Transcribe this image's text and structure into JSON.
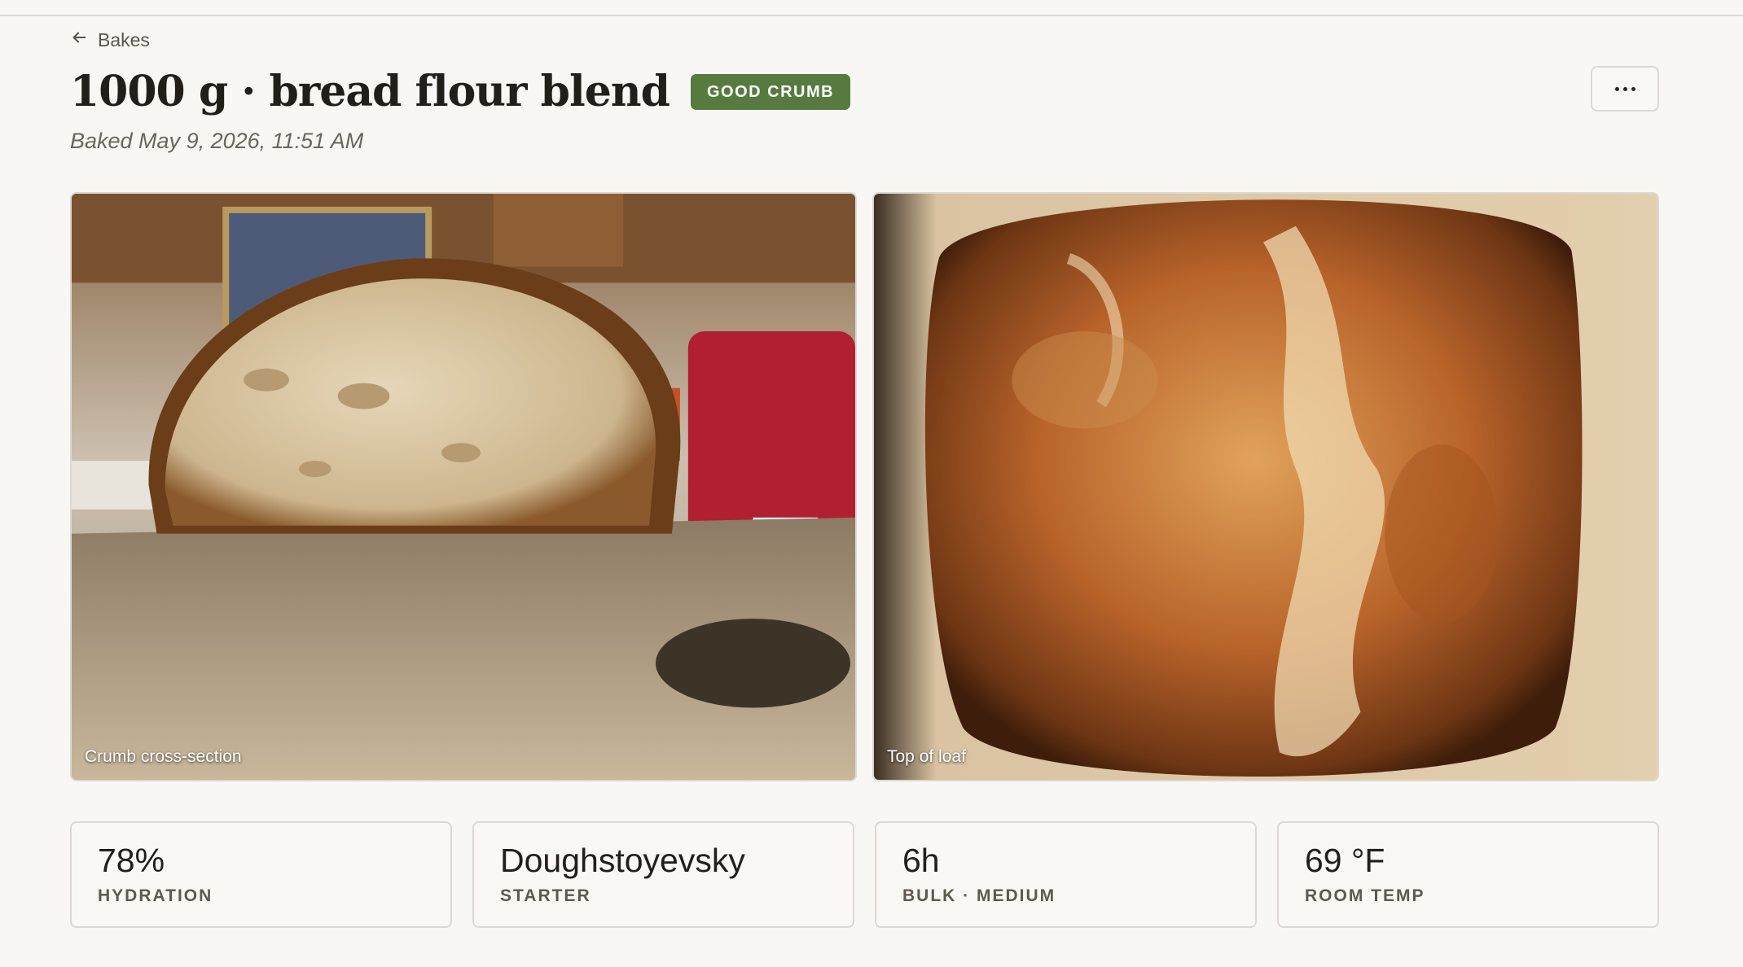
{
  "nav": {
    "back_label": "Bakes"
  },
  "bake": {
    "title": "1000 g · bread flour blend",
    "badge": "GOOD CRUMB",
    "baked_at": "Baked May 9, 2026, 11:51 AM"
  },
  "photos": [
    {
      "caption": "Crumb cross-section"
    },
    {
      "caption": "Top of loaf"
    }
  ],
  "stats": [
    {
      "value": "78%",
      "label": "HYDRATION"
    },
    {
      "value": "Doughstoyevsky",
      "label": "STARTER"
    },
    {
      "value": "6h",
      "label": "BULK · MEDIUM"
    },
    {
      "value": "69 °F",
      "label": "ROOM TEMP"
    }
  ],
  "colors": {
    "background": "#f9f7f4",
    "badge": "#577a3f",
    "border": "#dcd8d2"
  },
  "icons": {
    "back": "arrow-left-icon",
    "more": "more-horizontal-icon"
  }
}
